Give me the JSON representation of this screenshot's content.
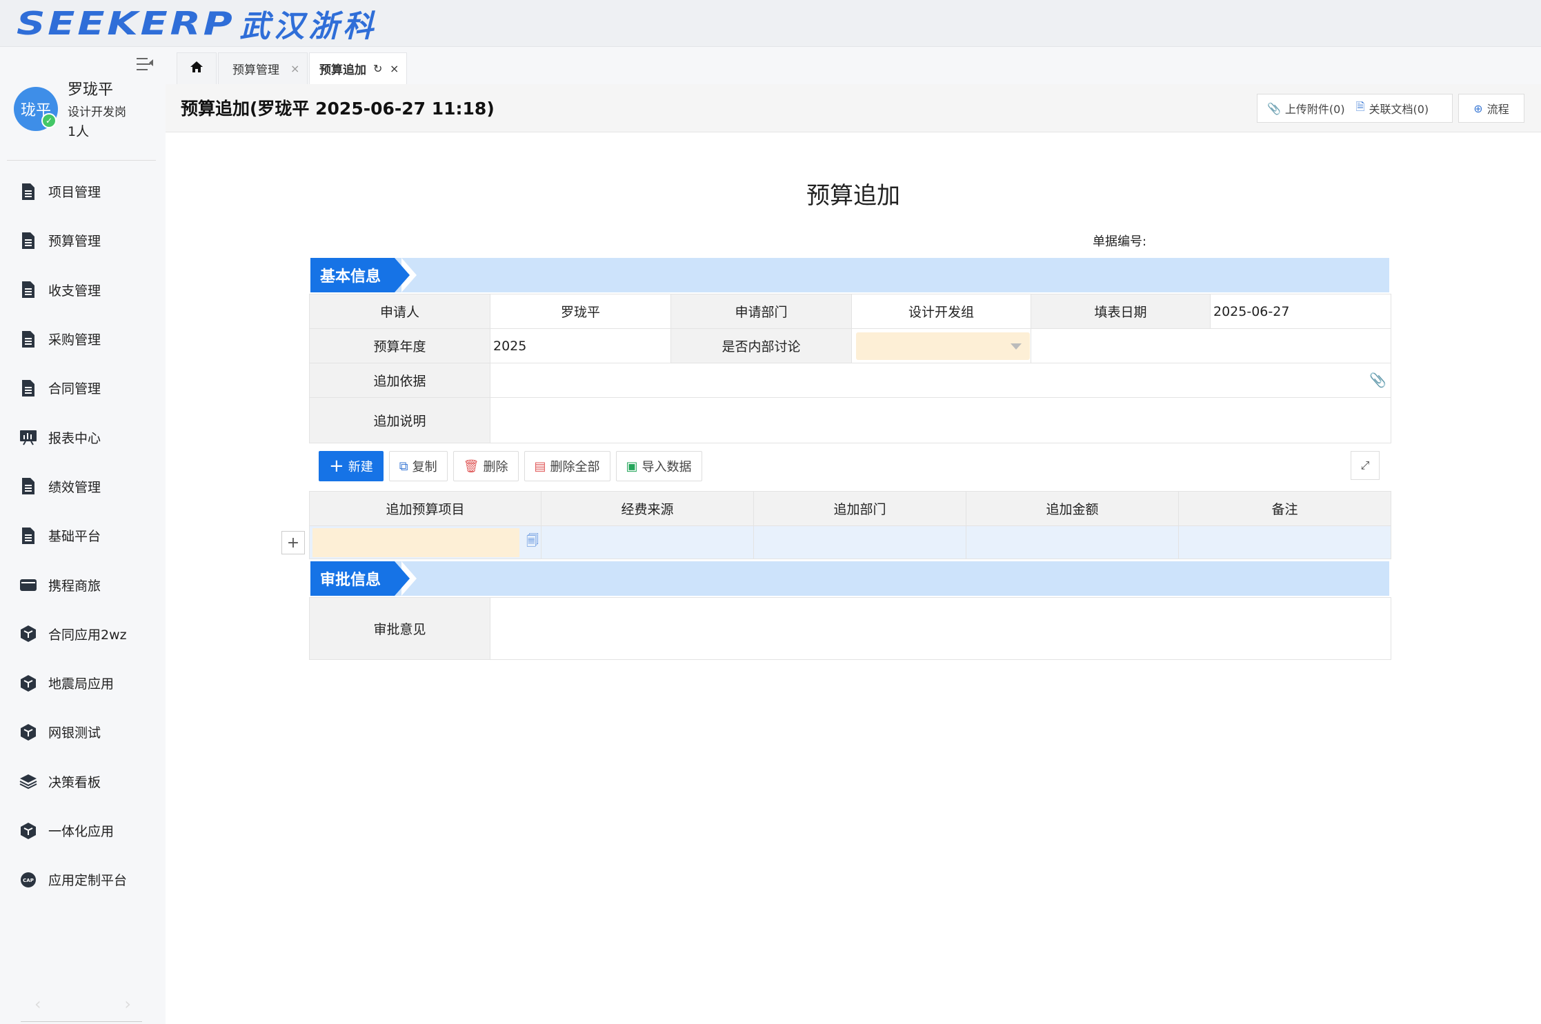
{
  "header": {
    "logo_text": "SEEKERP",
    "logo_cn": "武汉浙科"
  },
  "user": {
    "avatar_text": "珑平",
    "name": "罗珑平",
    "role": "设计开发岗",
    "count": "1人"
  },
  "sidebar": {
    "items": [
      {
        "label": "项目管理",
        "icon": "document-icon"
      },
      {
        "label": "预算管理",
        "icon": "document-icon"
      },
      {
        "label": "收支管理",
        "icon": "document-icon"
      },
      {
        "label": "采购管理",
        "icon": "document-icon"
      },
      {
        "label": "合同管理",
        "icon": "document-icon"
      },
      {
        "label": "报表中心",
        "icon": "presentation-icon"
      },
      {
        "label": "绩效管理",
        "icon": "document-icon"
      },
      {
        "label": "基础平台",
        "icon": "document-icon"
      },
      {
        "label": "携程商旅",
        "icon": "wallet-icon"
      },
      {
        "label": "合同应用2wz",
        "icon": "cube-icon"
      },
      {
        "label": "地震局应用",
        "icon": "cube-icon"
      },
      {
        "label": "网银测试",
        "icon": "cube-icon"
      },
      {
        "label": "决策看板",
        "icon": "layers-icon"
      },
      {
        "label": "一体化应用",
        "icon": "cube-icon"
      },
      {
        "label": "应用定制平台",
        "icon": "cap-icon"
      }
    ],
    "prev_arrow": "‹",
    "next_arrow": "›"
  },
  "tabs": [
    {
      "label": "预算管理"
    },
    {
      "label": "预算追加"
    }
  ],
  "page": {
    "title": "预算追加(罗珑平 2025-06-27 11:18)",
    "upload_label": "上传附件(0)",
    "related_docs_label": "关联文档(0)",
    "flow_label": "流程"
  },
  "form": {
    "title": "预算追加",
    "doc_no_label": "单据编号:",
    "section_basic": "基本信息",
    "applicant_label": "申请人",
    "applicant_value": "罗珑平",
    "dept_label": "申请部门",
    "dept_value": "设计开发组",
    "date_label": "填表日期",
    "date_value": "2025-06-27",
    "year_label": "预算年度",
    "year_value": "2025",
    "internal_label": "是否内部讨论",
    "basis_label": "追加依据",
    "desc_label": "追加说明",
    "section_approval": "审批信息",
    "approval_label": "审批意见"
  },
  "toolbar": {
    "new_label": "新建",
    "copy_label": "复制",
    "delete_label": "删除",
    "delete_all_label": "删除全部",
    "import_label": "导入数据"
  },
  "grid": {
    "columns": [
      "追加预算项目",
      "经费来源",
      "追加部门",
      "追加金额",
      "备注"
    ]
  },
  "colors": {
    "primary": "#1673e6",
    "section_bg": "#cde3fb",
    "required_field": "#fdefd6"
  }
}
